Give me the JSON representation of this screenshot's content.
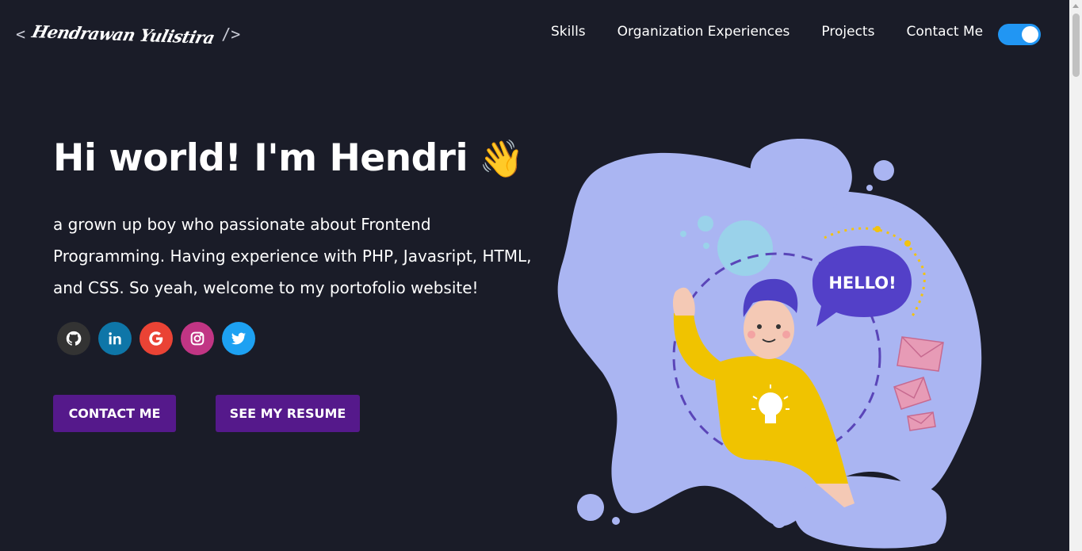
{
  "header": {
    "logo": {
      "open_bracket": "<",
      "signature": "Hendrawan Yulistira",
      "close_bracket": "/>"
    },
    "nav": [
      {
        "label": "Skills"
      },
      {
        "label": "Organization Experiences"
      },
      {
        "label": "Projects"
      },
      {
        "label": "Contact Me"
      }
    ],
    "theme_toggle": {
      "state": "on",
      "color": "#2196f3"
    }
  },
  "hero": {
    "greeting": "Hi world! I'm Hendri",
    "greeting_emoji": "👋",
    "intro": "a grown up boy who passionate about Frontend Programming. Having experience with PHP, Javasript, HTML, and CSS. So yeah, welcome to my portofolio website!",
    "socials": [
      {
        "icon": "github-icon",
        "color": "#333333"
      },
      {
        "icon": "linkedin-icon",
        "color": "#0e76a8"
      },
      {
        "icon": "google-icon",
        "color": "#ea4335"
      },
      {
        "icon": "instagram-icon",
        "color": "#c13584"
      },
      {
        "icon": "twitter-icon",
        "color": "#1da1f2"
      }
    ],
    "buttons": {
      "contact": "CONTACT ME",
      "resume": "SEE MY RESUME"
    },
    "illustration": {
      "speech_bubble": "HELLO!"
    }
  },
  "colors": {
    "background": "#1a1c28",
    "button": "#55198b",
    "blob": "#aab5f2"
  }
}
